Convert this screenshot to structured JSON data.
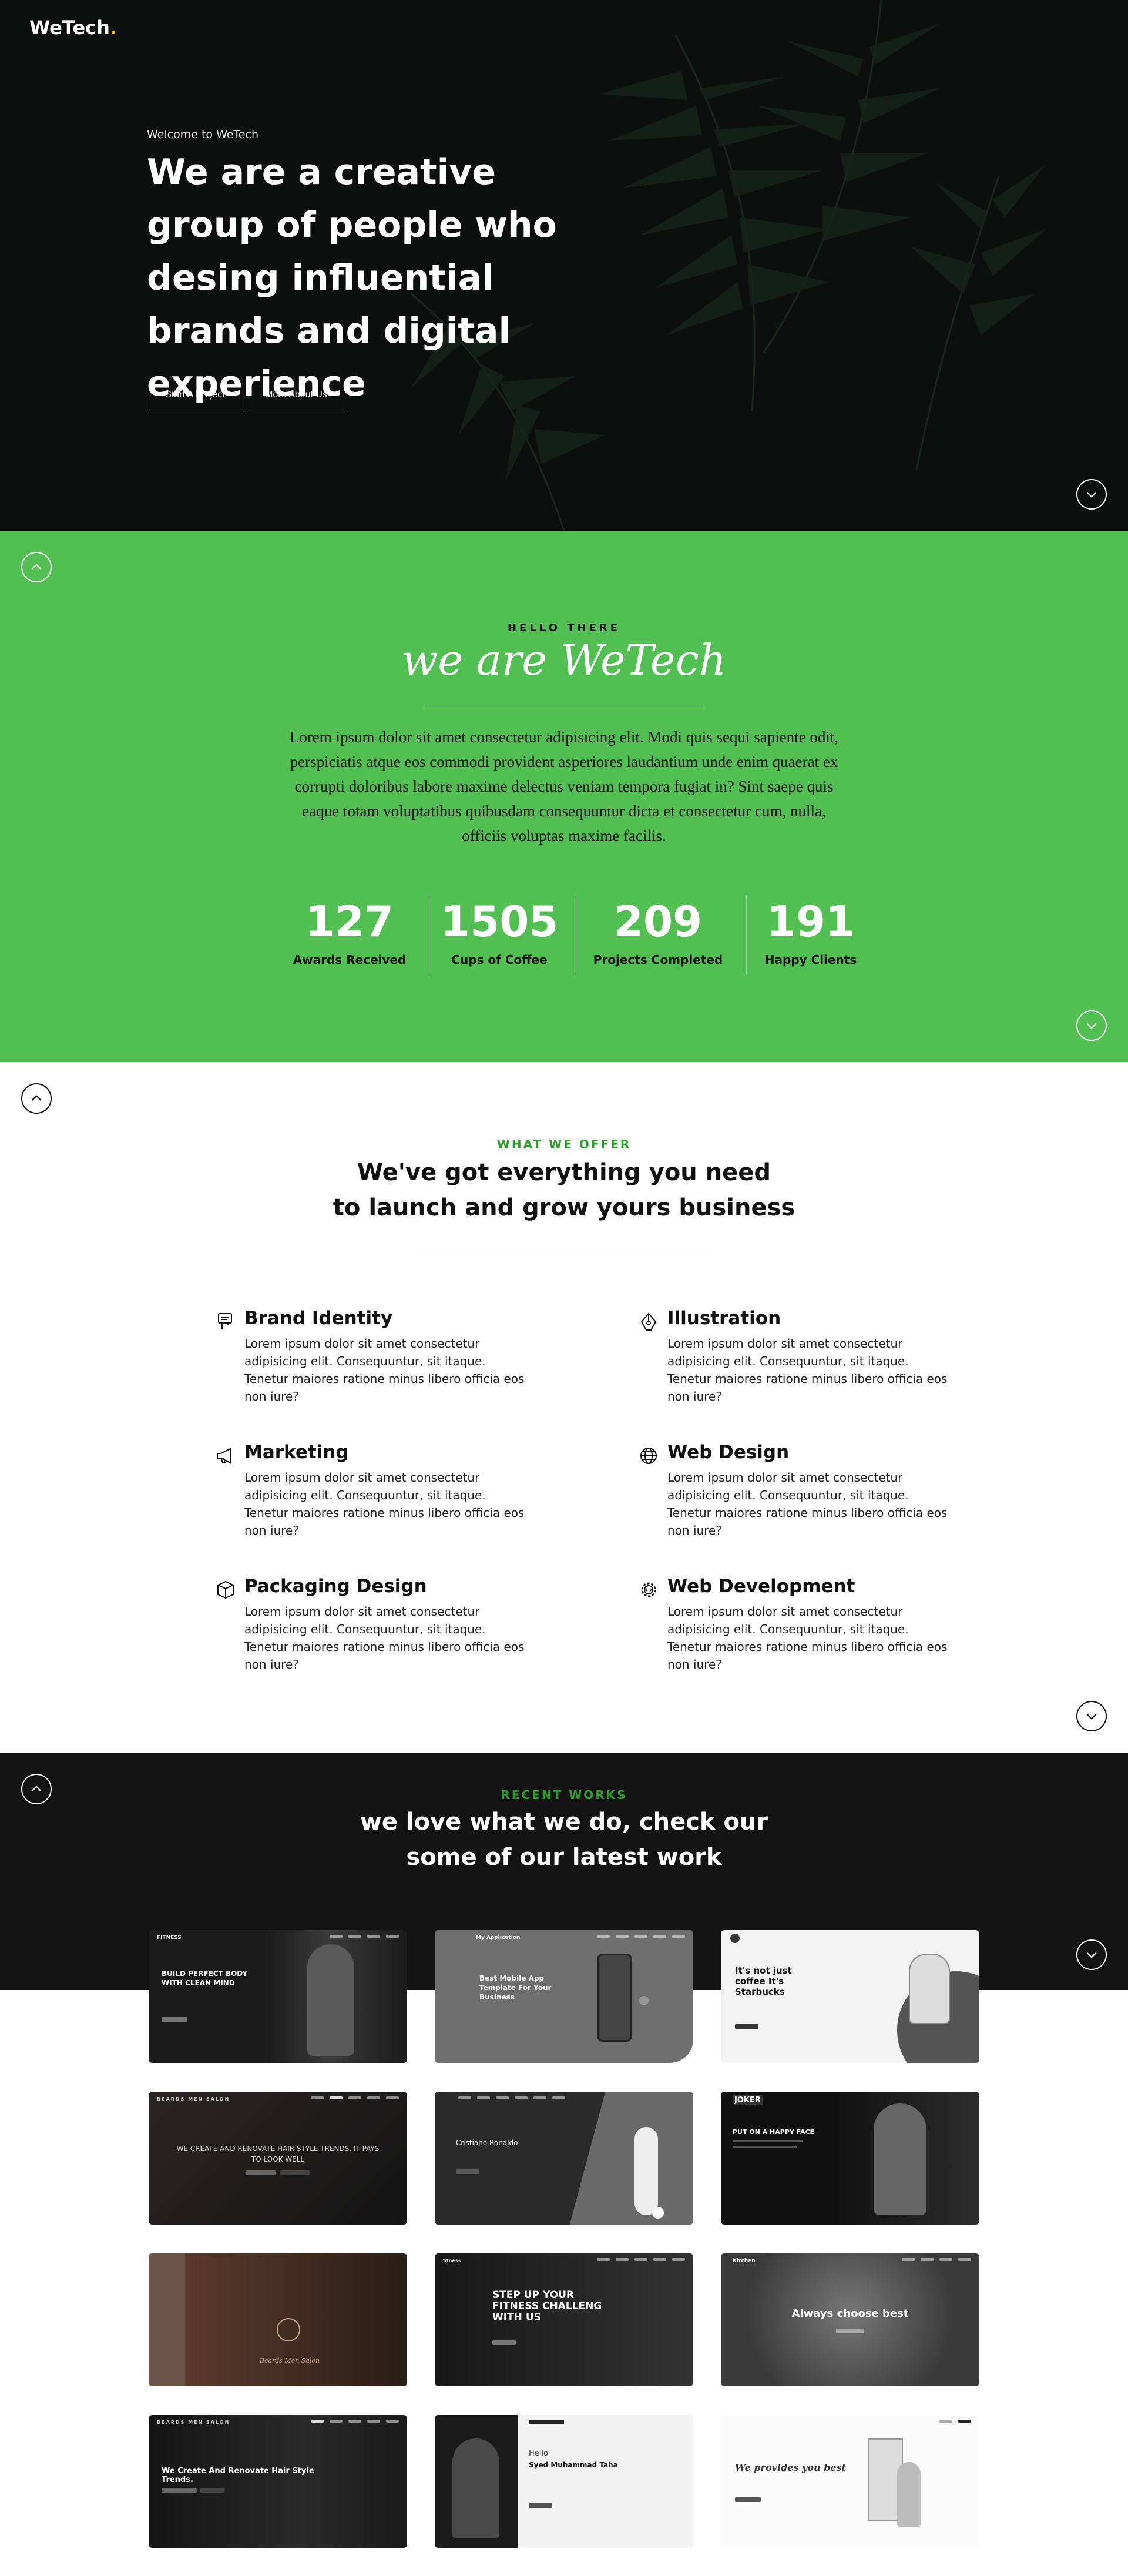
{
  "brand": {
    "name": "WeTech",
    "dot": "."
  },
  "hero": {
    "eyebrow": "Welcome to WeTech",
    "title": "We are a creative group of people who desing influential brands and digital experience",
    "buttons": [
      "Start A Project",
      "More About Us"
    ]
  },
  "about": {
    "eyebrow": "HELLO THERE",
    "script_title": "we are WeTech",
    "paragraph": "Lorem ipsum dolor sit amet consectetur adipisicing elit. Modi quis sequi sapiente odit, perspiciatis atque eos commodi provident asperiores laudantium unde enim quaerat ex corrupti doloribus labore maxime delectus veniam tempora fugiat in? Sint saepe quis eaque totam voluptatibus quibusdam consequuntur dicta et consectetur cum, nulla, officiis voluptas maxime facilis.",
    "stats": [
      {
        "value": "127",
        "label": "Awards Received"
      },
      {
        "value": "1505",
        "label": "Cups of Coffee"
      },
      {
        "value": "209",
        "label": "Projects Completed"
      },
      {
        "value": "191",
        "label": "Happy Clients"
      }
    ]
  },
  "services": {
    "eyebrow": "WHAT WE OFFER",
    "title_line1": "We've got everything you need",
    "title_line2": "to launch and grow yours business",
    "items": [
      {
        "name": "Brand Identity",
        "icon": "brand-identity-icon",
        "desc": "Lorem ipsum dolor sit amet consectetur adipisicing elit. Consequuntur, sit itaque. Tenetur maiores ratione minus libero officia eos non iure?"
      },
      {
        "name": "Illustration",
        "icon": "illustration-icon",
        "desc": "Lorem ipsum dolor sit amet consectetur adipisicing elit. Consequuntur, sit itaque. Tenetur maiores ratione minus libero officia eos non iure?"
      },
      {
        "name": "Marketing",
        "icon": "megaphone-icon",
        "desc": "Lorem ipsum dolor sit amet consectetur adipisicing elit. Consequuntur, sit itaque. Tenetur maiores ratione minus libero officia eos non iure?"
      },
      {
        "name": "Web Design",
        "icon": "globe-icon",
        "desc": "Lorem ipsum dolor sit amet consectetur adipisicing elit. Consequuntur, sit itaque. Tenetur maiores ratione minus libero officia eos non iure?"
      },
      {
        "name": "Packaging Design",
        "icon": "package-icon",
        "desc": "Lorem ipsum dolor sit amet consectetur adipisicing elit. Consequuntur, sit itaque. Tenetur maiores ratione minus libero officia eos non iure?"
      },
      {
        "name": "Web Development",
        "icon": "gear-code-icon",
        "desc": "Lorem ipsum dolor sit amet consectetur adipisicing elit. Consequuntur, sit itaque. Tenetur maiores ratione minus libero officia eos non iure?"
      }
    ]
  },
  "works": {
    "eyebrow": "RECENT WORKS",
    "title_line1": "we love what we do, check our",
    "title_line2": "some of our latest work",
    "thumbs": [
      {
        "caption": "BUILD PERFECT BODY WITH CLEAN MIND",
        "tag": "FITNESS"
      },
      {
        "caption": "Best Mobile App Template For Your Business",
        "tag": "My Application"
      },
      {
        "caption": "It's not just coffee It's Starbucks",
        "tag": ""
      },
      {
        "caption": "WE CREATE AND RENOVATE HAIR STYLE TRENDS. IT PAYS TO LOOK WELL",
        "tag": "BEARDS MEN SALON"
      },
      {
        "caption": "Cristiano Ronaldo",
        "tag": ""
      },
      {
        "caption": "PUT ON A HAPPY FACE",
        "tag": "JOKER"
      },
      {
        "caption": "Beards Men Salon",
        "tag": ""
      },
      {
        "caption": "STEP UP YOUR FITNESS CHALLENG WITH US",
        "tag": "fitness"
      },
      {
        "caption": "Always choose best",
        "tag": "Kitchen"
      },
      {
        "caption": "We Create And Renovate Hair Style Trends.",
        "tag": "BEARDS MEN SALON"
      },
      {
        "caption": "Syed Muhammad Taha",
        "tag": "Hello"
      },
      {
        "caption": "We provides you best",
        "tag": ""
      }
    ]
  },
  "colors": {
    "green": "#52bf52",
    "accent_green": "#2a9d2a",
    "dark": "#131313",
    "brand_dot": "#f2c200"
  }
}
